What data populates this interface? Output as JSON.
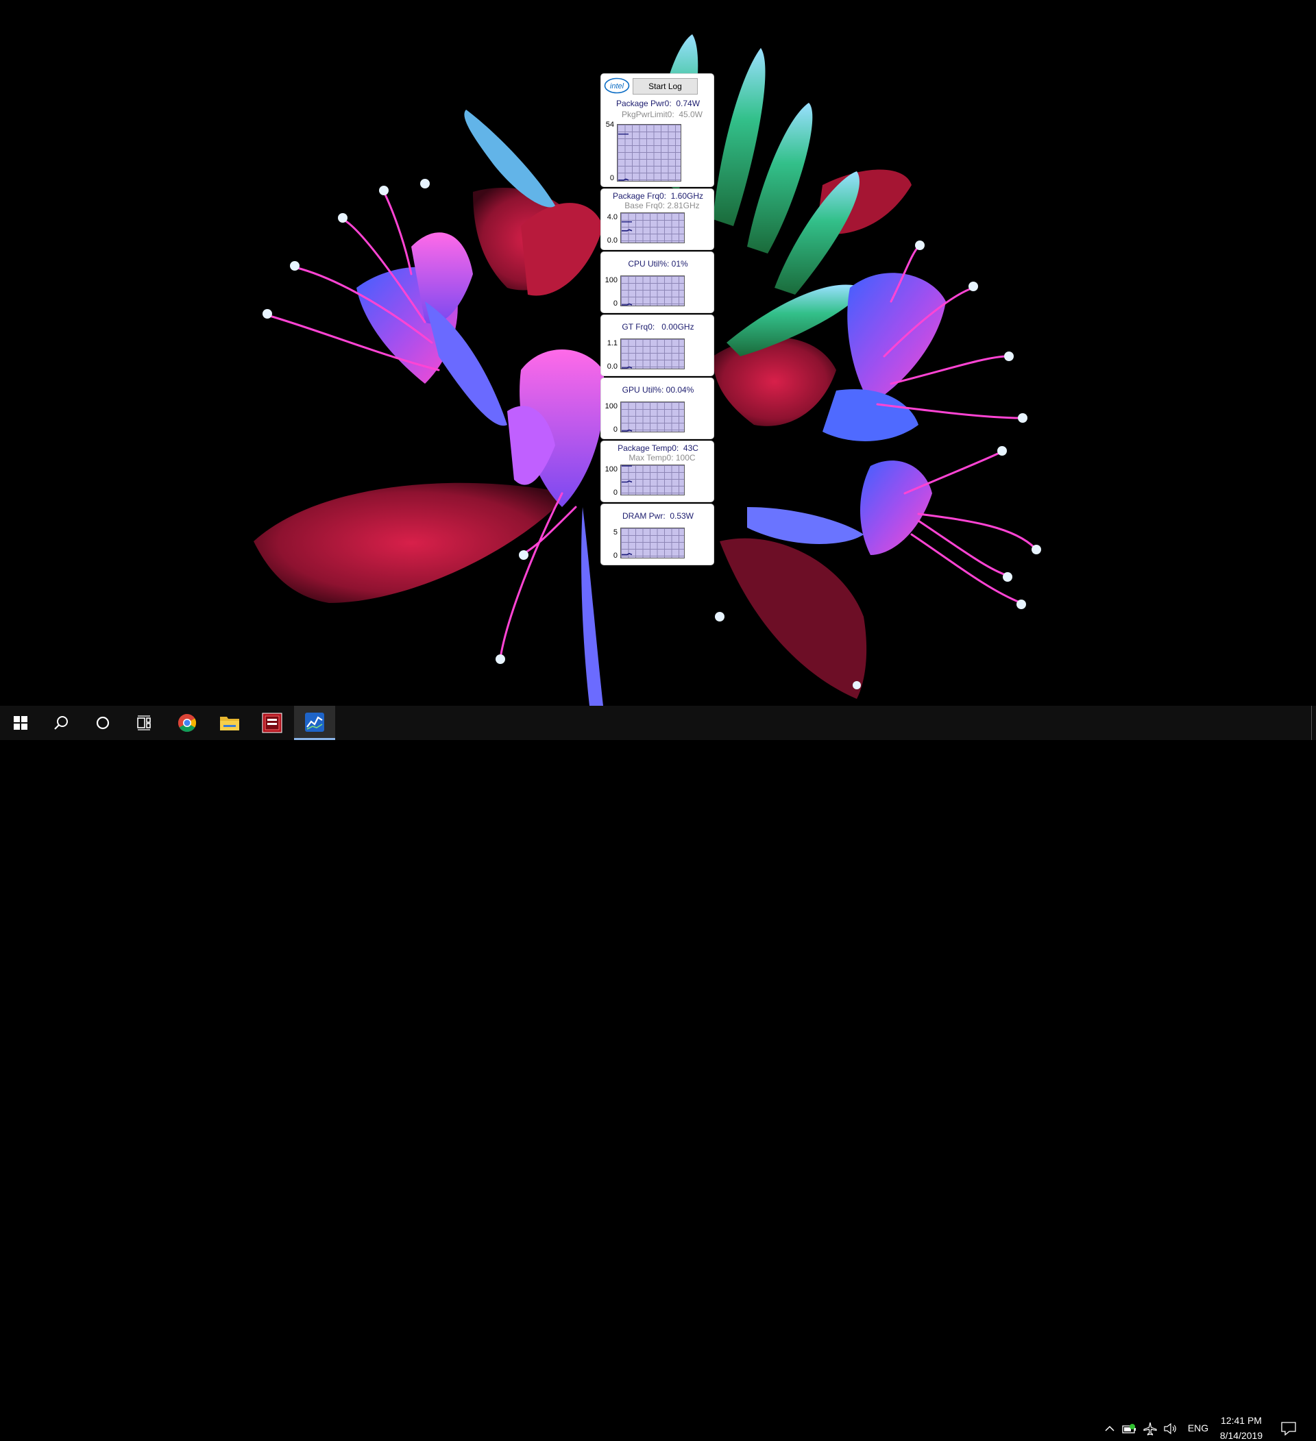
{
  "gadget": {
    "logo": "intel",
    "start_log_label": "Start Log",
    "panels": [
      {
        "id": "package-power",
        "title": "Package Pwr0:  0.74W",
        "subtitle": "PkgPwrLimit0:  45.0W",
        "y_max": "54",
        "y_min": "0",
        "limit_fraction": 0.833,
        "value_fraction": 0.014
      },
      {
        "id": "package-frequency",
        "title": "Package Frq0:  1.60GHz",
        "subtitle": "Base Frq0: 2.81GHz",
        "y_max": "4.0",
        "y_min": "0.0",
        "limit_fraction": 0.7025,
        "value_fraction": 0.4
      },
      {
        "id": "cpu-utilization",
        "title": "CPU Util%: 01%",
        "subtitle": "",
        "y_max": "100",
        "y_min": "0",
        "limit_fraction": null,
        "value_fraction": 0.01
      },
      {
        "id": "gt-frequency",
        "title": "GT Frq0:   0.00GHz",
        "subtitle": "",
        "y_max": "1.1",
        "y_min": "0.0",
        "limit_fraction": null,
        "value_fraction": 0.0
      },
      {
        "id": "gpu-utilization",
        "title": "GPU Util%: 00.04%",
        "subtitle": "",
        "y_max": "100",
        "y_min": "0",
        "limit_fraction": null,
        "value_fraction": 0.0
      },
      {
        "id": "package-temperature",
        "title": "Package Temp0:  43C",
        "subtitle": "Max Temp0: 100C",
        "y_max": "100",
        "y_min": "0",
        "limit_fraction": 1.0,
        "value_fraction": 0.43
      },
      {
        "id": "dram-power",
        "title": "DRAM Pwr:  0.53W",
        "subtitle": "",
        "y_max": "5",
        "y_min": "0",
        "limit_fraction": null,
        "value_fraction": 0.106
      }
    ]
  },
  "taskbar": {
    "apps": [
      {
        "name": "start-button",
        "icon": "windows-logo-icon"
      },
      {
        "name": "search-button",
        "icon": "search-icon"
      },
      {
        "name": "cortana-button",
        "icon": "cortana-ring-icon"
      },
      {
        "name": "task-view-button",
        "icon": "task-view-icon"
      },
      {
        "name": "chrome-taskbar-button",
        "icon": "chrome-icon"
      },
      {
        "name": "file-explorer-taskbar-button",
        "icon": "folder-icon"
      },
      {
        "name": "cpuz-taskbar-button",
        "icon": "cpuz-icon"
      },
      {
        "name": "power-gadget-taskbar-button",
        "icon": "power-gadget-icon",
        "active": true
      }
    ],
    "tray": {
      "language": "ENG",
      "time": "12:41 PM",
      "date": "8/14/2019"
    }
  },
  "colors": {
    "graph_bg": "#c8c2ec",
    "grid": "#8d86b6",
    "trace": "#1a1a7a",
    "title_text": "#1c1c6e",
    "subtitle_text": "#8c8c8c",
    "taskbar": "#101010",
    "intel_blue": "#0a6cc4"
  }
}
